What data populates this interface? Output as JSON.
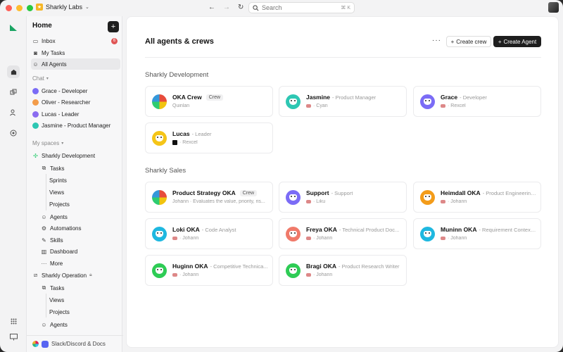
{
  "app": {
    "workspace_name": "Sharkly Labs",
    "search_placeholder": "Search",
    "search_shortcut": "⌘ K"
  },
  "sidebar": {
    "home_label": "Home",
    "top_items": [
      {
        "label": "Inbox",
        "badge": "6",
        "icon": "inbox-icon"
      },
      {
        "label": "My Tasks",
        "icon": "tasks-icon"
      },
      {
        "label": "All Agents",
        "icon": "agents-icon"
      }
    ],
    "chat_label": "Chat",
    "chats": [
      {
        "label": "Grace - Developer",
        "color": "#7b6cf6"
      },
      {
        "label": "Oliver - Researcher",
        "color": "#f39c4a"
      },
      {
        "label": "Lucas - Leader",
        "color": "#8a6cf0"
      },
      {
        "label": "Jasmine - Product Manager",
        "color": "#2ec7b3"
      }
    ],
    "spaces_label": "My spaces",
    "space1": {
      "name": "Sharkly Development",
      "tasks": "Tasks",
      "task_children": [
        "Sprints",
        "Views",
        "Projects"
      ],
      "items": [
        "Agents",
        "Automations",
        "Skills",
        "Dashboard",
        "More"
      ]
    },
    "space2": {
      "name": "Sharkly Operation",
      "tasks": "Tasks",
      "task_children": [
        "Views",
        "Projects"
      ],
      "items": [
        "Agents"
      ]
    },
    "footer_label": "Slack/Discord & Docs"
  },
  "main": {
    "title": "All agents & crews",
    "more_label": "···",
    "create_crew_label": "Create crew",
    "create_agent_label": "Create Agent",
    "groups": [
      {
        "title": "Sharkly Development",
        "cards": [
          {
            "name": "OKA Crew",
            "role": "",
            "tag": "Crew",
            "sub": "Quinlan",
            "color": "crew"
          },
          {
            "name": "Jasmine",
            "role": "- Product Manager",
            "tag": "",
            "sub": "· Cyan",
            "color": "#2ec7b3"
          },
          {
            "name": "Grace",
            "role": "- Developer",
            "tag": "",
            "sub": "· Rexcel",
            "color": "#7b6cf6"
          },
          {
            "name": "Lucas",
            "role": "- Leader",
            "tag": "",
            "sub": "· Rexcel",
            "color": "#f5c518"
          }
        ]
      },
      {
        "title": "Sharkly Sales",
        "cards": [
          {
            "name": "Product Strategy OKA",
            "role": "",
            "tag": "Crew",
            "sub": "Johann · Evaluates the value, priority, ris...",
            "color": "crew"
          },
          {
            "name": "Support",
            "role": "- Support",
            "tag": "",
            "sub": "· Liku",
            "color": "#7b6cf6"
          },
          {
            "name": "Heimdall OKA",
            "role": "- Product Engineering...",
            "tag": "",
            "sub": "· Johann",
            "color": "#f39c1a"
          },
          {
            "name": "Loki OKA",
            "role": "- Code Analyst",
            "tag": "",
            "sub": "· Johann",
            "color": "#1fb8e0"
          },
          {
            "name": "Freya OKA",
            "role": "- Technical Product Doc...",
            "tag": "",
            "sub": "· Johann",
            "color": "#f07a6a"
          },
          {
            "name": "Muninn OKA",
            "role": "- Requirement Context...",
            "tag": "",
            "sub": "· Johann",
            "color": "#1fb8e0"
          },
          {
            "name": "Huginn OKA",
            "role": "- Competitive Technica...",
            "tag": "",
            "sub": "· Johann",
            "color": "#2ecc55"
          },
          {
            "name": "Bragi OKA",
            "role": "- Product Research Writer",
            "tag": "",
            "sub": "· Johann",
            "color": "#2ecc55"
          }
        ]
      }
    ]
  }
}
